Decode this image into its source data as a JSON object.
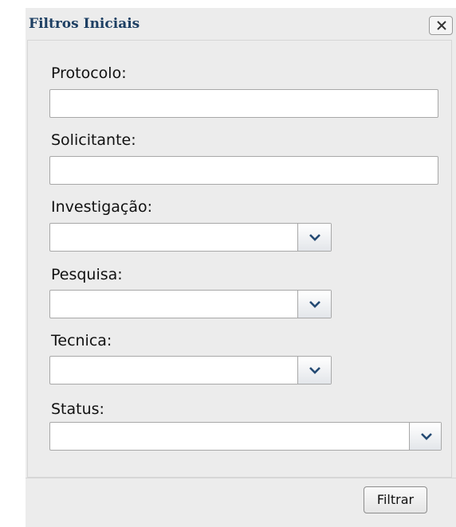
{
  "dialog": {
    "title": "Filtros Iniciais",
    "close_icon": "close-icon"
  },
  "fields": {
    "protocolo": {
      "label": "Protocolo:",
      "value": ""
    },
    "solicitante": {
      "label": "Solicitante:",
      "value": ""
    },
    "investigacao": {
      "label": "Investigação:",
      "selected": ""
    },
    "pesquisa": {
      "label": "Pesquisa:",
      "selected": ""
    },
    "tecnica": {
      "label": "Tecnica:",
      "selected": ""
    },
    "status": {
      "label": "Status:",
      "selected": ""
    }
  },
  "footer": {
    "filter_label": "Filtrar"
  },
  "colors": {
    "title": "#1d3f63",
    "panel_bg": "#ececec",
    "arrow": "#244a73"
  }
}
